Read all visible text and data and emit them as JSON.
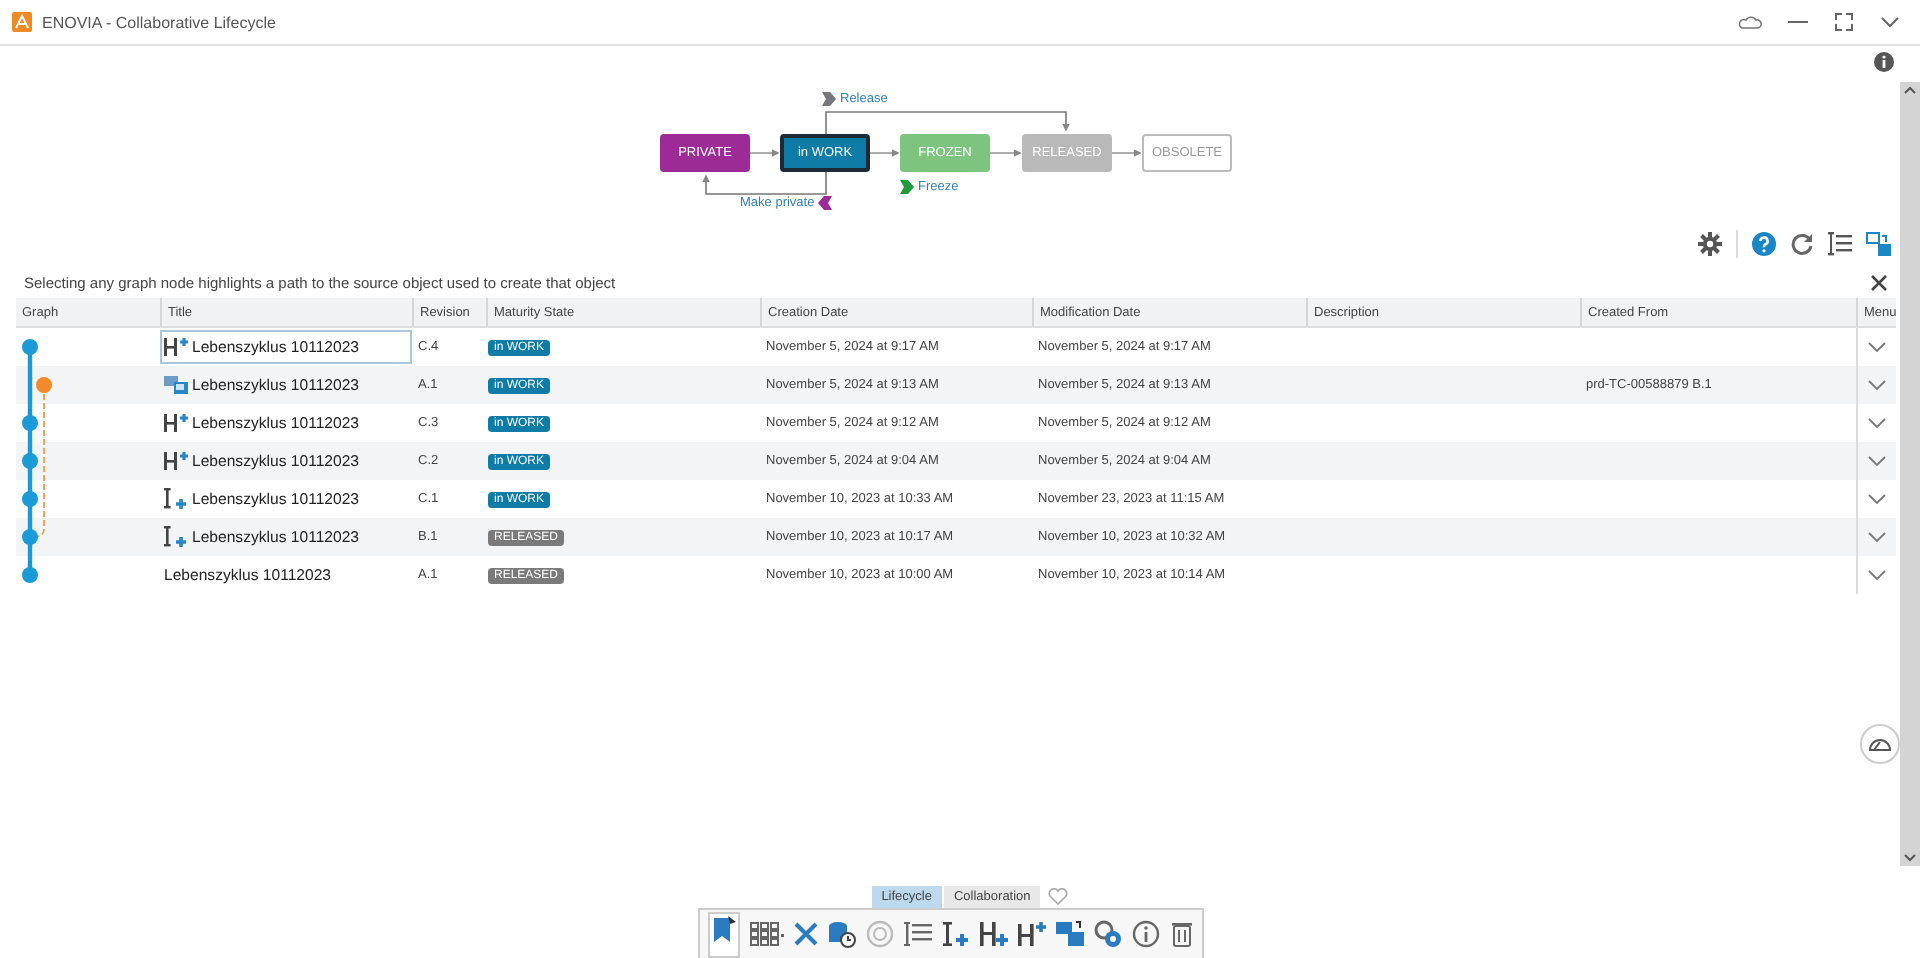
{
  "window": {
    "title": "ENOVIA - Collaborative Lifecycle"
  },
  "lifecycle": {
    "states": [
      {
        "label": "PRIVATE",
        "color": "#9c2b97",
        "kind": "filled",
        "current": false
      },
      {
        "label": "in WORK",
        "color": "#0e7ca6",
        "kind": "filled",
        "current": true
      },
      {
        "label": "FROZEN",
        "color": "#7dc47f",
        "kind": "filled",
        "current": false
      },
      {
        "label": "RELEASED",
        "color": "#b9b9b9",
        "kind": "filled",
        "current": false
      },
      {
        "label": "OBSOLETE",
        "color": "#ffffff",
        "kind": "outlined",
        "current": false
      }
    ],
    "transitions": [
      {
        "label": "Release",
        "kind": "release",
        "color": "#77777a"
      },
      {
        "label": "Freeze",
        "kind": "freeze",
        "color": "#1f9a3a"
      },
      {
        "label": "Make private",
        "kind": "demote",
        "color": "#9c2b97"
      }
    ]
  },
  "hint": "Selecting any graph node highlights a path to the source object used to create that object",
  "table": {
    "columns": [
      "Graph",
      "Title",
      "Revision",
      "Maturity State",
      "Creation Date",
      "Modification Date",
      "Description",
      "Created From",
      "Menu"
    ],
    "rows": [
      {
        "graph": {
          "kind": "main"
        },
        "kind": "hierarchy",
        "title": "Lebenszyklus 10112023",
        "revision": "C.4",
        "state": {
          "label": "in WORK",
          "color": "#0e7ca6"
        },
        "created": "November 5, 2024 at 9:17 AM",
        "modified": "November 5, 2024 at 9:17 AM",
        "selected": true
      },
      {
        "graph": {
          "kind": "branch"
        },
        "kind": "replace",
        "title": "Lebenszyklus 10112023",
        "revision": "A.1",
        "state": {
          "label": "in WORK",
          "color": "#0e7ca6"
        },
        "created": "November 5, 2024 at 9:13 AM",
        "modified": "November 5, 2024 at 9:13 AM",
        "created_from": "prd-TC-00588879 B.1",
        "selected": false
      },
      {
        "graph": {
          "kind": "main"
        },
        "kind": "hierarchy",
        "title": "Lebenszyklus 10112023",
        "revision": "C.3",
        "state": {
          "label": "in WORK",
          "color": "#0e7ca6"
        },
        "created": "November 5, 2024 at 9:12 AM",
        "modified": "November 5, 2024 at 9:12 AM",
        "selected": false
      },
      {
        "graph": {
          "kind": "main"
        },
        "kind": "hierarchy",
        "title": "Lebenszyklus 10112023",
        "revision": "C.2",
        "state": {
          "label": "in WORK",
          "color": "#0e7ca6"
        },
        "created": "November 5, 2024 at 9:04 AM",
        "modified": "November 5, 2024 at 9:04 AM",
        "selected": false
      },
      {
        "graph": {
          "kind": "main"
        },
        "kind": "part",
        "title": "Lebenszyklus 10112023",
        "revision": "C.1",
        "state": {
          "label": "in WORK",
          "color": "#0e7ca6"
        },
        "created": "November 10, 2023 at 10:33 AM",
        "modified": "November 23, 2023 at 11:15 AM",
        "selected": false
      },
      {
        "graph": {
          "kind": "merge"
        },
        "kind": "part",
        "title": "Lebenszyklus 10112023",
        "revision": "B.1",
        "state": {
          "label": "RELEASED",
          "color": "#7a7a7a"
        },
        "created": "November 10, 2023 at 10:17 AM",
        "modified": "November 10, 2023 at 10:32 AM",
        "selected": false
      },
      {
        "graph": {
          "kind": "main"
        },
        "title": "Lebenszyklus 10112023",
        "revision": "A.1",
        "state": {
          "label": "RELEASED",
          "color": "#7a7a7a"
        },
        "created": "November 10, 2023 at 10:00 AM",
        "modified": "November 10, 2023 at 10:14 AM",
        "selected": false
      }
    ]
  },
  "bottom_tabs": [
    {
      "label": "Lifecycle",
      "selected": true
    },
    {
      "label": "Collaboration",
      "selected": false
    }
  ]
}
